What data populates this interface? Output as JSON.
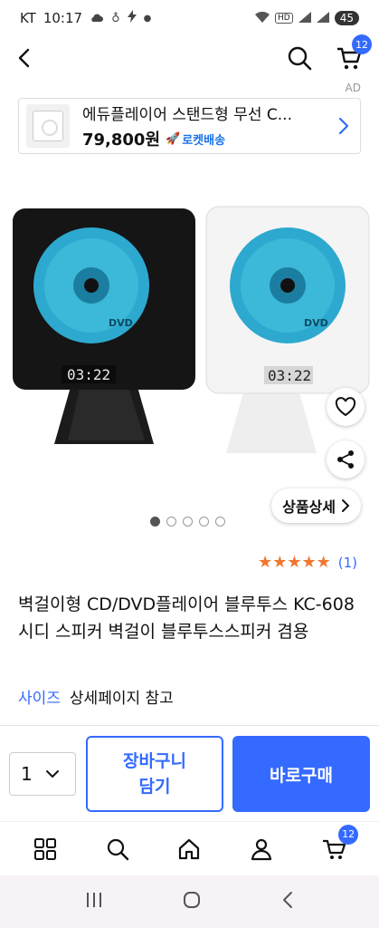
{
  "status_bar": {
    "carrier": "KT",
    "time": "10:17",
    "battery": "45",
    "hd_label": "HD"
  },
  "header": {
    "cart_count": "12"
  },
  "ad": {
    "label": "AD",
    "title": "에듀플레이어 스탠드형 무선 C...",
    "price": "79,800원",
    "delivery": "로켓배송"
  },
  "image": {
    "display_text": "03:22",
    "disc_text": "DVD",
    "detail_button": "상품상세",
    "dots_count": 5,
    "active_dot": 0
  },
  "rating": {
    "stars": 5,
    "review_count": "(1)"
  },
  "product": {
    "title": "벽걸이형 CD/DVD플레이어 블루투스 KC-608 시디 스피커 벽걸이 블루투스스피커 겸용",
    "option_label": "사이즈",
    "option_value": "상세페이지 참고"
  },
  "purchase": {
    "quantity": "1",
    "cart_label_1": "장바구니",
    "cart_label_2": "담기",
    "buy_label": "바로구매"
  },
  "bottom_nav": {
    "cart_count": "12",
    "items": [
      "category-icon",
      "search-icon",
      "home-icon",
      "mypage-icon",
      "cart-icon"
    ]
  },
  "colors": {
    "brand_blue": "#346aff",
    "star_orange": "#f2762e",
    "disc_cyan": "#3cb8d8"
  }
}
